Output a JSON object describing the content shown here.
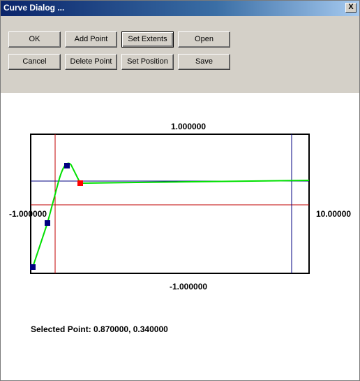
{
  "window": {
    "title": "Curve Dialog ...",
    "close_glyph": "X"
  },
  "buttons": {
    "ok": "OK",
    "add_point": "Add Point",
    "set_extents": "Set Extents",
    "open": "Open",
    "cancel": "Cancel",
    "delete_point": "Delete Point",
    "set_position": "Set Position",
    "save": "Save"
  },
  "plot": {
    "top_label": "1.000000",
    "bottom_label": "-1.000000",
    "left_label": "-1.000000",
    "right_label": "10.00000",
    "colors": {
      "curve": "#00e000",
      "point": "#000080",
      "selected_point": "#ff0000",
      "red_line": "#c00000",
      "blue_line": "#000080"
    }
  },
  "status": {
    "selected_point": "Selected Point: 0.870000, 0.340000"
  }
}
